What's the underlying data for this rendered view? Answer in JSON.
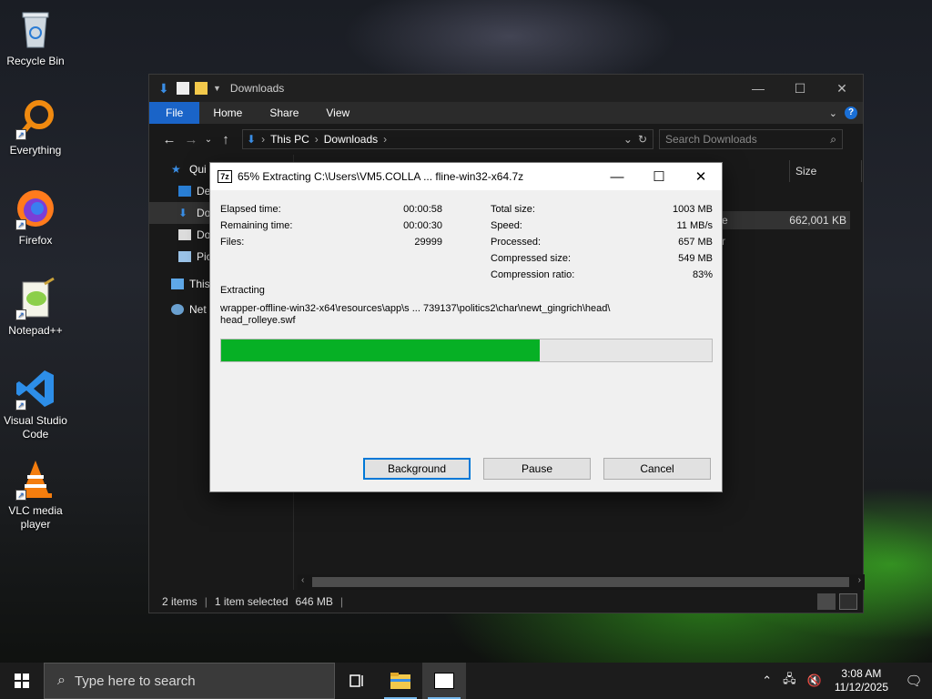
{
  "desktop": {
    "icons": [
      {
        "label": "Recycle Bin"
      },
      {
        "label": "Everything"
      },
      {
        "label": "Firefox"
      },
      {
        "label": "Notepad++"
      },
      {
        "label": "Visual Studio Code"
      },
      {
        "label": "VLC media player"
      }
    ]
  },
  "explorer": {
    "title": "Downloads",
    "ribbon_tabs": [
      "File",
      "Home",
      "Share",
      "View"
    ],
    "address": {
      "root": "This PC",
      "folder": "Downloads"
    },
    "search_placeholder": "Search Downloads",
    "nav_items": [
      "Qui",
      "De",
      "Do",
      "Do",
      "Pic",
      "This",
      "Net"
    ],
    "column_size_header": "Size",
    "selected_row": {
      "name_partial": "e",
      "size": "662,001 KB"
    },
    "other_row_partial": "r",
    "status": {
      "items": "2 items",
      "selected": "1 item selected",
      "size": "646 MB"
    }
  },
  "dialog": {
    "title": "65% Extracting C:\\Users\\VM5.COLLA ... fline-win32-x64.7z",
    "icon_text": "7z",
    "stats_left": [
      {
        "label": "Elapsed time:",
        "value": "00:00:58"
      },
      {
        "label": "Remaining time:",
        "value": "00:00:30"
      },
      {
        "label": "Files:",
        "value": "29999"
      }
    ],
    "stats_right": [
      {
        "label": "Total size:",
        "value": "1003 MB"
      },
      {
        "label": "Speed:",
        "value": "11 MB/s"
      },
      {
        "label": "Processed:",
        "value": "657 MB"
      },
      {
        "label": "Compressed size:",
        "value": "549 MB"
      },
      {
        "label": "Compression ratio:",
        "value": "83%"
      }
    ],
    "extracting_label": "Extracting",
    "extracting_path_line1": "wrapper-offline-win32-x64\\resources\\app\\s ... 739137\\politics2\\char\\newt_gingrich\\head\\",
    "extracting_path_line2": "head_rolleye.swf",
    "progress_percent": 65,
    "buttons": {
      "background": "Background",
      "pause": "Pause",
      "cancel": "Cancel"
    }
  },
  "taskbar": {
    "search_placeholder": "Type here to search",
    "time": "3:08 AM",
    "date": "11/12/2025"
  },
  "colors": {
    "progress_fill": "#06b025",
    "file_tab": "#1a64c8",
    "accent": "#0078d7"
  }
}
